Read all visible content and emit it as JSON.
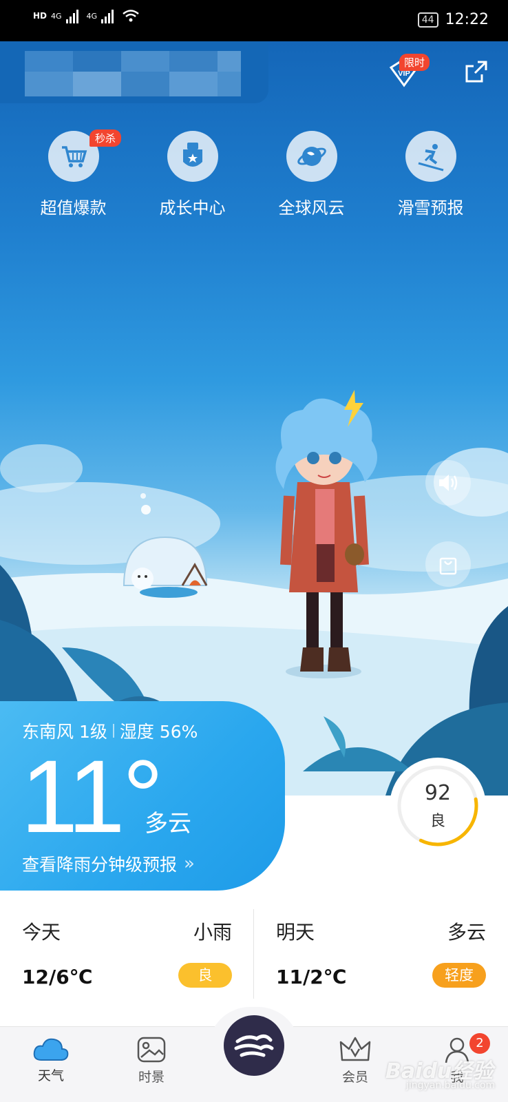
{
  "status_bar": {
    "hd1": "HD",
    "net1": "4G",
    "net2": "4G",
    "battery": "44",
    "time": "12:22"
  },
  "header": {
    "vip_label": "VIP",
    "limited_tag": "限时"
  },
  "quick_menu": {
    "sale_tag": "秒杀",
    "items": [
      {
        "label": "超值爆款",
        "icon": "shopping-cart-icon"
      },
      {
        "label": "成长中心",
        "icon": "badge-icon"
      },
      {
        "label": "全球风云",
        "icon": "planet-icon"
      },
      {
        "label": "滑雪预报",
        "icon": "skier-icon"
      }
    ]
  },
  "current": {
    "wind": "东南风 1级",
    "humidity": "湿度 56%",
    "temperature": "11°",
    "condition": "多云",
    "rain_link": "查看降雨分钟级预报",
    "rain_arrow": "»"
  },
  "aqi": {
    "value": "92",
    "level": "良",
    "progress": 0.35,
    "color": "#f7b500"
  },
  "forecast": {
    "today": {
      "name": "今天",
      "condition": "小雨",
      "temp": "12/6℃",
      "aqi": "良",
      "aqi_color": "#fbc02d"
    },
    "tomorrow": {
      "name": "明天",
      "condition": "多云",
      "temp": "11/2℃",
      "aqi": "轻度",
      "aqi_color": "#f7a01d"
    }
  },
  "bottom_nav": {
    "items": [
      {
        "label": "天气",
        "icon": "cloud-icon"
      },
      {
        "label": "时景",
        "icon": "picture-icon"
      },
      {
        "label": "会员",
        "icon": "crown-icon"
      },
      {
        "label": "我",
        "icon": "user-icon"
      }
    ],
    "me_badge": "2"
  },
  "watermark": {
    "main": "Baidu经验",
    "sub": "jingyan.baidu.com"
  },
  "colors": {
    "accent": "#2aa7ee",
    "sky_top": "#1466b8",
    "red_tag": "#f2452f",
    "center_button": "#2f2c4a"
  }
}
